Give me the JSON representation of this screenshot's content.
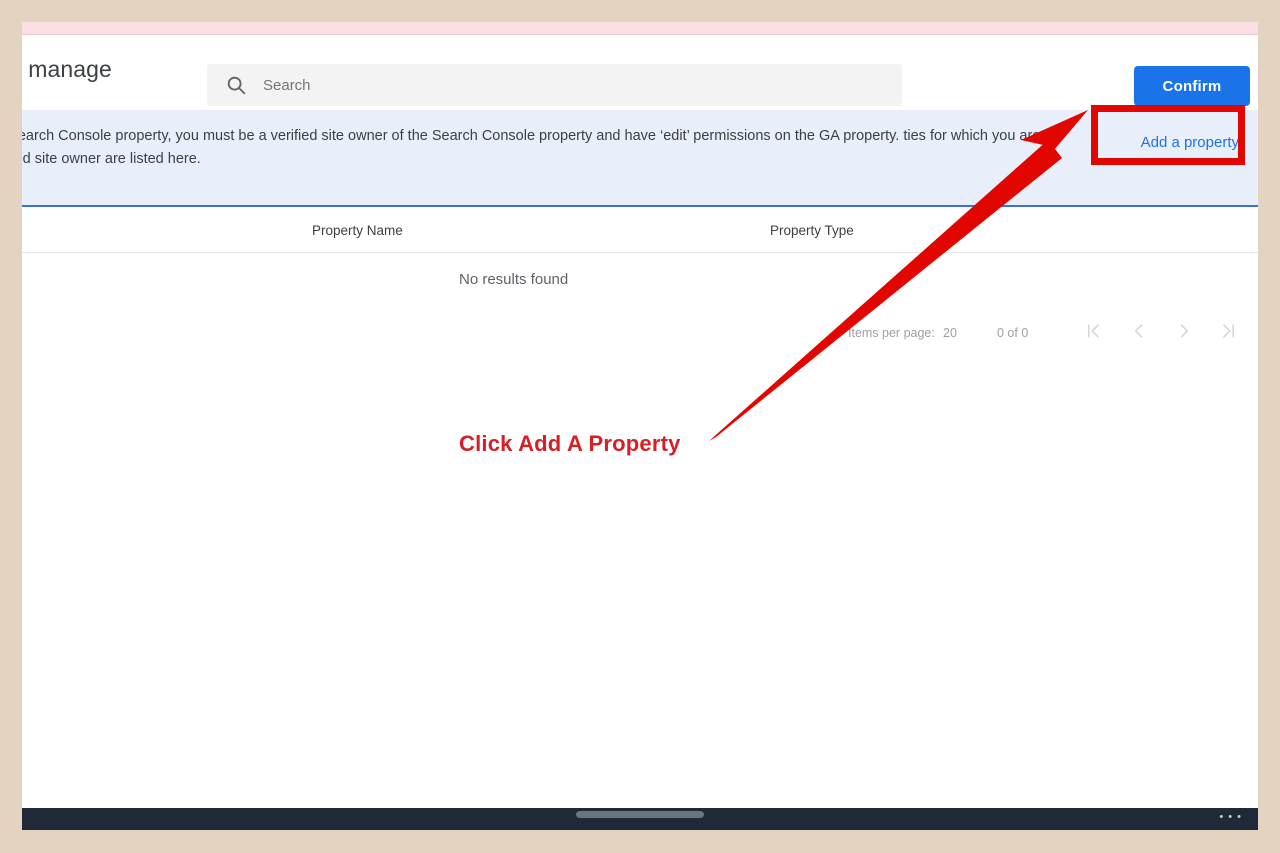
{
  "app": {
    "dialog_title": "Select a Search Console property I manage",
    "dialog_title_visible": "erty I manage"
  },
  "search": {
    "icon": "search-icon",
    "placeholder": "Search",
    "value": ""
  },
  "actions": {
    "confirm_label": "Confirm",
    "add_property_label": "Add a property"
  },
  "banner": {
    "text": "To link a Google Analytics property to a Search Console property, you must be a verified site owner of the Search Console property and have 'edit' permissions on the GA property. Only properties for which you are a verified site owner are listed here.",
    "text_visible": "o a Search Console property, you must be a verified site owner of the Search Console property and have ‘edit’ permissions on the GA property. ties for which you are a verified site owner are listed here.",
    "background_color": "#e9eefb",
    "border_color": "#3b6fd4"
  },
  "table": {
    "columns": [
      "Property Name",
      "Property Type"
    ],
    "rows": [],
    "empty_message": "No results found"
  },
  "paginator": {
    "items_per_page_label": "Items per page:",
    "items_per_page_value": "20",
    "range_label": "0 of 0",
    "buttons": [
      {
        "name": "first-page",
        "icon": "first-page-icon"
      },
      {
        "name": "previous-page",
        "icon": "chevron-left-icon"
      },
      {
        "name": "next-page",
        "icon": "chevron-right-icon"
      },
      {
        "name": "last-page",
        "icon": "last-page-icon"
      }
    ]
  },
  "system_nav": {
    "dots": "• • •"
  },
  "annotation": {
    "callout_text": "Click Add A Property",
    "color": "#d81f26",
    "box_color": "#e10600"
  },
  "colors": {
    "accent": "#1a73e8",
    "link": "#1a73e8",
    "frame": "#e2d4c1",
    "status_strip": "#fcdfe2"
  }
}
